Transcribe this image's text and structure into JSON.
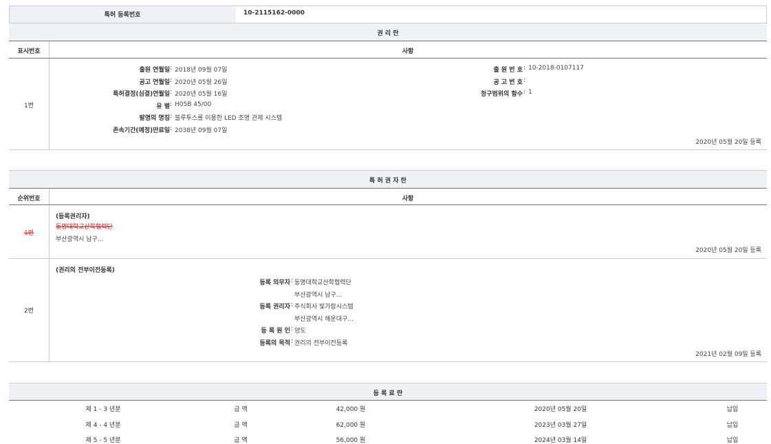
{
  "top": {
    "label": "특허 등록번호",
    "value": "10-2115162-0000"
  },
  "rights": {
    "title": "권 리 란",
    "col1": "표시번호",
    "col2": "사항",
    "row": {
      "number": "1번",
      "left_fields": [
        {
          "label": "출원 연월일",
          "value": "2018년 09월 07일"
        },
        {
          "label": "공고 연월일",
          "value": "2020년 05월 26일"
        },
        {
          "label": "특허결정(심결)연월일",
          "value": "2020년 05월 16일"
        },
        {
          "label": "유 별",
          "value": "H05B 45/00"
        },
        {
          "label": "발명의 명칭",
          "value": "블루투스를 이용한 LED 조명 관제 시스템"
        },
        {
          "label": "존속기간(예정)만료일",
          "value": "2038년 09월 07일"
        }
      ],
      "right_fields": [
        {
          "label": "출 원 번 호",
          "value": "10-2018-0107117"
        },
        {
          "label": "공 고 번 호",
          "value": ""
        },
        {
          "label": "청구범위의 항수",
          "value": "1"
        }
      ],
      "reg_date": "2020년 05월 20일 등록"
    }
  },
  "holders": {
    "title": "특 허 권 자 란",
    "col1": "순위번호",
    "col2": "사항",
    "row1": {
      "number": "1번",
      "kind": "(등록권리자)",
      "name": "동명대학교산학협력단",
      "address": "부산광역시 남구...",
      "reg_date": "2020년 05월 20일 등록"
    },
    "row2": {
      "number": "2번",
      "kind": "(권리의 전부이전등록)",
      "fields": [
        {
          "label": "등록 의무자",
          "value": "동명대학교산학협력단"
        },
        {
          "label": "",
          "value": "부산광역시 남구..."
        },
        {
          "label": "등록 권리자",
          "value": "주식회사 빛가람시스템"
        },
        {
          "label": "",
          "value": "부산광역시 해운대구..."
        },
        {
          "label": "등 록 원 인",
          "value": "양도"
        },
        {
          "label": "등록의 목적",
          "value": "권리의 전부이전등록"
        }
      ],
      "reg_date": "2021년 02월 09일 등록"
    }
  },
  "fees": {
    "title": "등 록 료 란",
    "rows": [
      {
        "period": "제 1 - 3 년분",
        "amount_label": "금 액",
        "amount": "42,000 원",
        "date": "2020년 05월 20일",
        "status": "납입"
      },
      {
        "period": "제 4 - 4 년분",
        "amount_label": "금 액",
        "amount": "62,000 원",
        "date": "2023년 03월 27일",
        "status": "납입"
      },
      {
        "period": "제 5 - 5 년분",
        "amount_label": "금 액",
        "amount": "56,000 원",
        "date": "2024년 03월 14일",
        "status": "납입"
      }
    ]
  }
}
